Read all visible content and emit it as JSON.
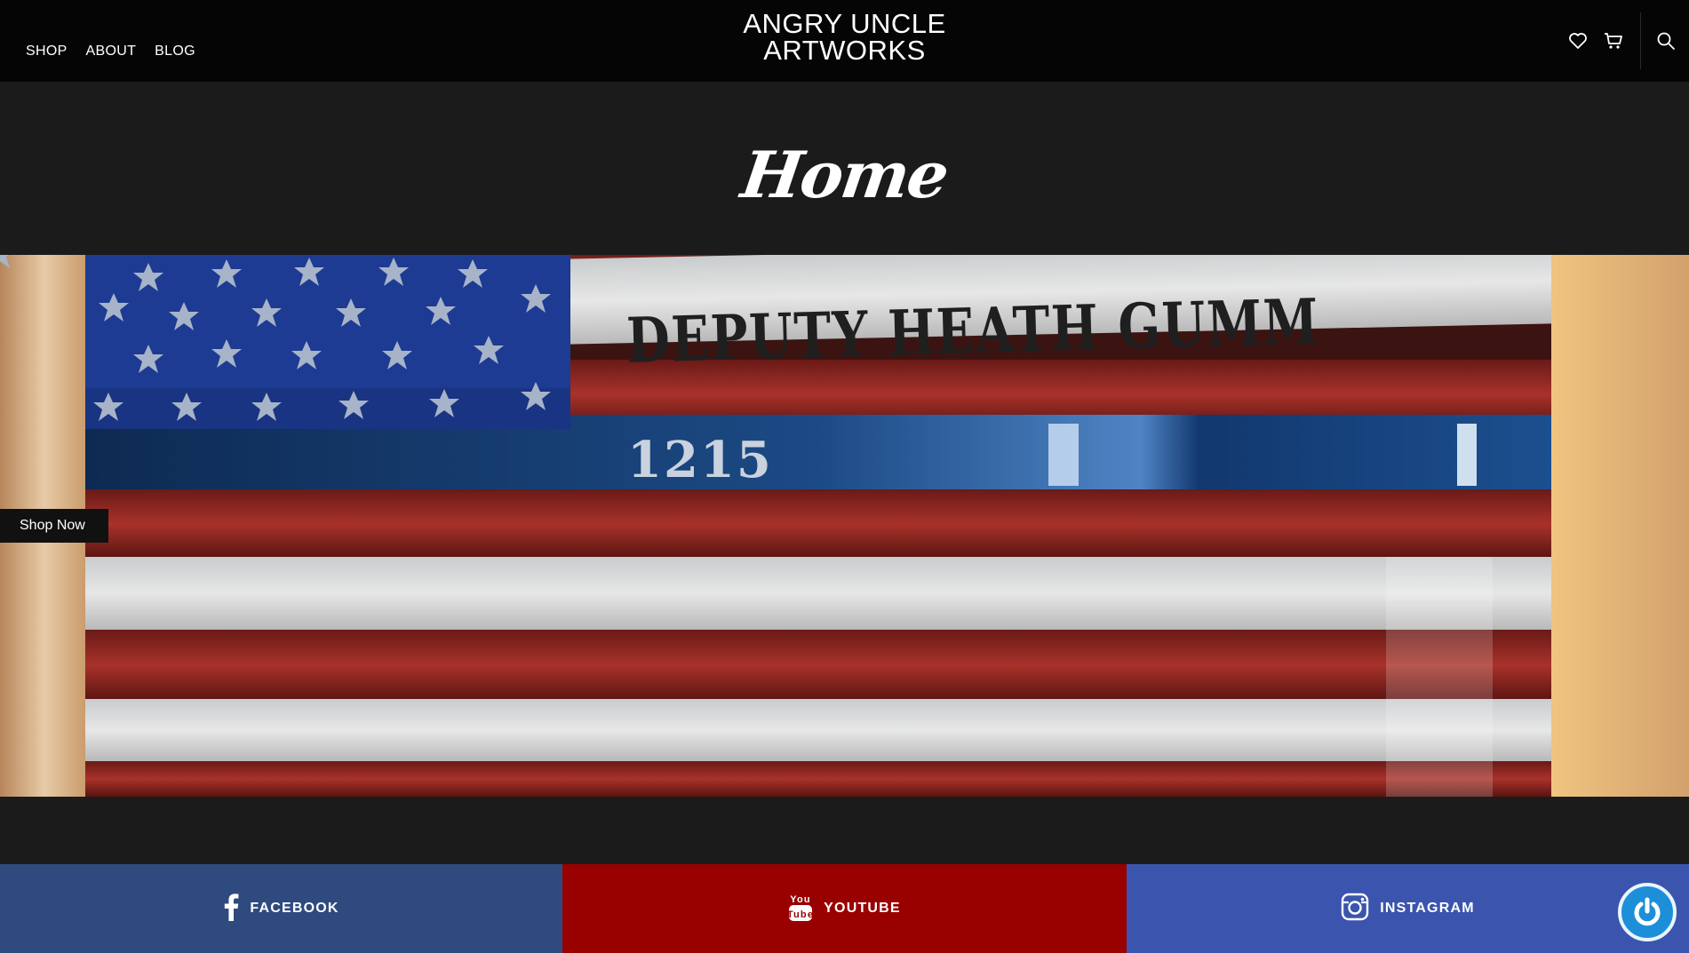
{
  "header": {
    "nav": [
      {
        "label": "SHOP"
      },
      {
        "label": "ABOUT"
      },
      {
        "label": "BLOG"
      }
    ],
    "logo_line1": "ANGRY UNCLE",
    "logo_line2": "ARTWORKS",
    "icons": [
      "heart-icon",
      "cart-icon",
      "search-icon"
    ]
  },
  "page": {
    "title": "Home"
  },
  "hero": {
    "flag_name": "DEPUTY HEATH GUMM",
    "flag_number": "1215",
    "cta_label": "Shop Now"
  },
  "social": {
    "facebook": "FACEBOOK",
    "youtube": "YOUTUBE",
    "youtube_logo_top": "You",
    "youtube_logo_bottom": "Tube",
    "instagram": "INSTAGRAM",
    "colors": {
      "facebook": "#2f4a7f",
      "youtube": "#990000",
      "instagram": "#3b55ae"
    }
  }
}
